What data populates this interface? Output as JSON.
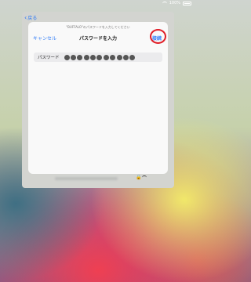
{
  "status_bar": {
    "battery_text": "100%"
  },
  "background_screen": {
    "back_label": "戻る"
  },
  "dialog": {
    "prompt": "\"BUFFALO\"のパスワードを入力してください",
    "cancel_label": "キャンセル",
    "title": "パスワードを入力",
    "join_label": "接続",
    "password_label": "パスワード",
    "password_dot_count": 11
  },
  "colors": {
    "accent": "#2f7bf6",
    "highlight_ring": "#e01e27"
  }
}
